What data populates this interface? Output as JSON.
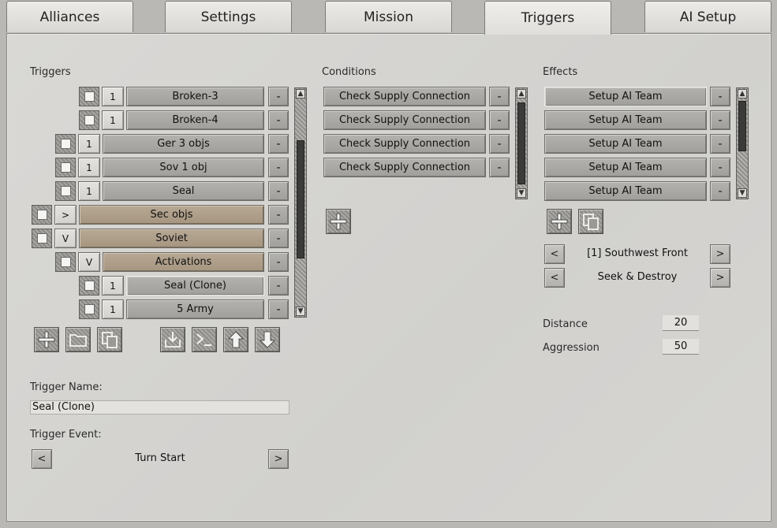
{
  "tabs": [
    {
      "label": "Alliances"
    },
    {
      "label": "Settings"
    },
    {
      "label": "Mission"
    },
    {
      "label": "Triggers"
    },
    {
      "label": "AI Setup"
    }
  ],
  "active_tab": "Triggers",
  "triggers": {
    "heading": "Triggers",
    "items": [
      {
        "order": "1",
        "label": "Broken-3",
        "type": "trigger"
      },
      {
        "order": "1",
        "label": "Broken-4",
        "type": "trigger"
      },
      {
        "order": "1",
        "label": "Ger 3 objs",
        "type": "trigger"
      },
      {
        "order": "1",
        "label": "Sov 1 obj",
        "type": "trigger"
      },
      {
        "order": "1",
        "label": "Seal",
        "type": "trigger"
      },
      {
        "order": ">",
        "label": "Sec objs",
        "type": "folder"
      },
      {
        "order": "V",
        "label": "Soviet",
        "type": "folder"
      },
      {
        "order": "V",
        "label": "Activations",
        "type": "folder"
      },
      {
        "order": "1",
        "label": "Seal (Clone)",
        "type": "trigger"
      },
      {
        "order": "1",
        "label": "5 Army",
        "type": "trigger"
      }
    ],
    "remove_label": "-"
  },
  "conditions": {
    "heading": "Conditions",
    "items": [
      {
        "label": "Check Supply Connection"
      },
      {
        "label": "Check Supply Connection"
      },
      {
        "label": "Check Supply Connection"
      },
      {
        "label": "Check Supply Connection"
      }
    ],
    "remove_label": "-"
  },
  "effects": {
    "heading": "Effects",
    "items": [
      {
        "label": "Setup AI Team"
      },
      {
        "label": "Setup AI Team"
      },
      {
        "label": "Setup AI Team"
      },
      {
        "label": "Setup AI Team"
      },
      {
        "label": "Setup AI Team"
      }
    ],
    "remove_label": "-",
    "team_selector": {
      "value": "[1] Southwest Front"
    },
    "order_selector": {
      "value": "Seek & Destroy"
    },
    "prev_label": "<",
    "next_label": ">",
    "distance": {
      "label": "Distance",
      "value": "20"
    },
    "aggression": {
      "label": "Aggression",
      "value": "50"
    }
  },
  "trigger_name": {
    "label": "Trigger Name:",
    "value": "Seal (Clone)"
  },
  "trigger_event": {
    "label": "Trigger Event:",
    "value": "Turn Start",
    "prev_label": "<",
    "next_label": ">"
  }
}
